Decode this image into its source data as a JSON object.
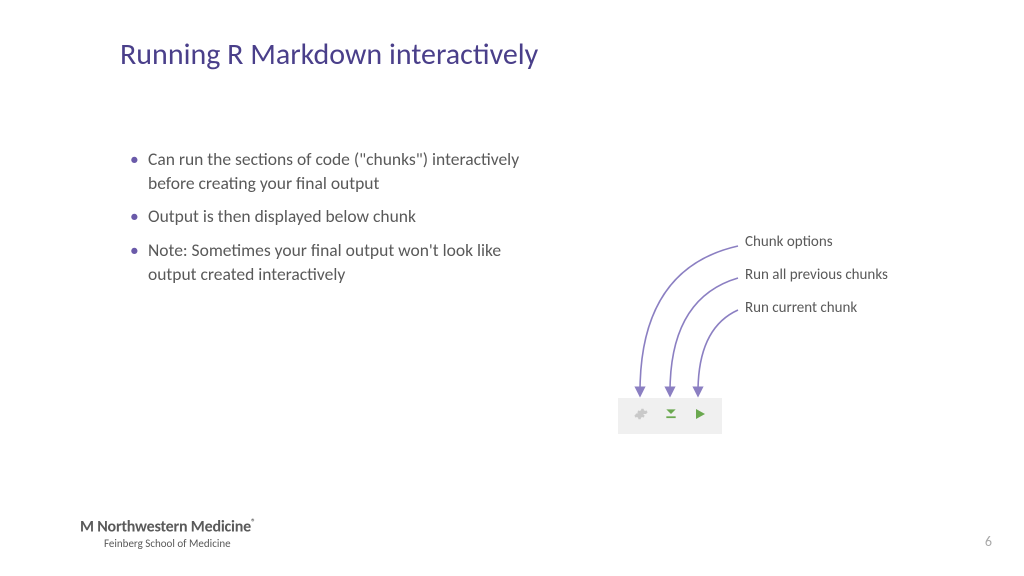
{
  "title": "Running R Markdown interactively",
  "bullets": [
    "Can run the sections of code (\"chunks\") interactively before creating your final output",
    "Output is then displayed below chunk",
    "Note: Sometimes your final output won't look like output created interactively"
  ],
  "callouts": {
    "opt": "Chunk options",
    "prev": "Run all previous chunks",
    "cur": "Run current chunk"
  },
  "logo": {
    "brand_prefix": "M",
    "brand": "Northwestern Medicine",
    "reg": "®",
    "sub": "Feinberg School of Medicine"
  },
  "page": "6"
}
